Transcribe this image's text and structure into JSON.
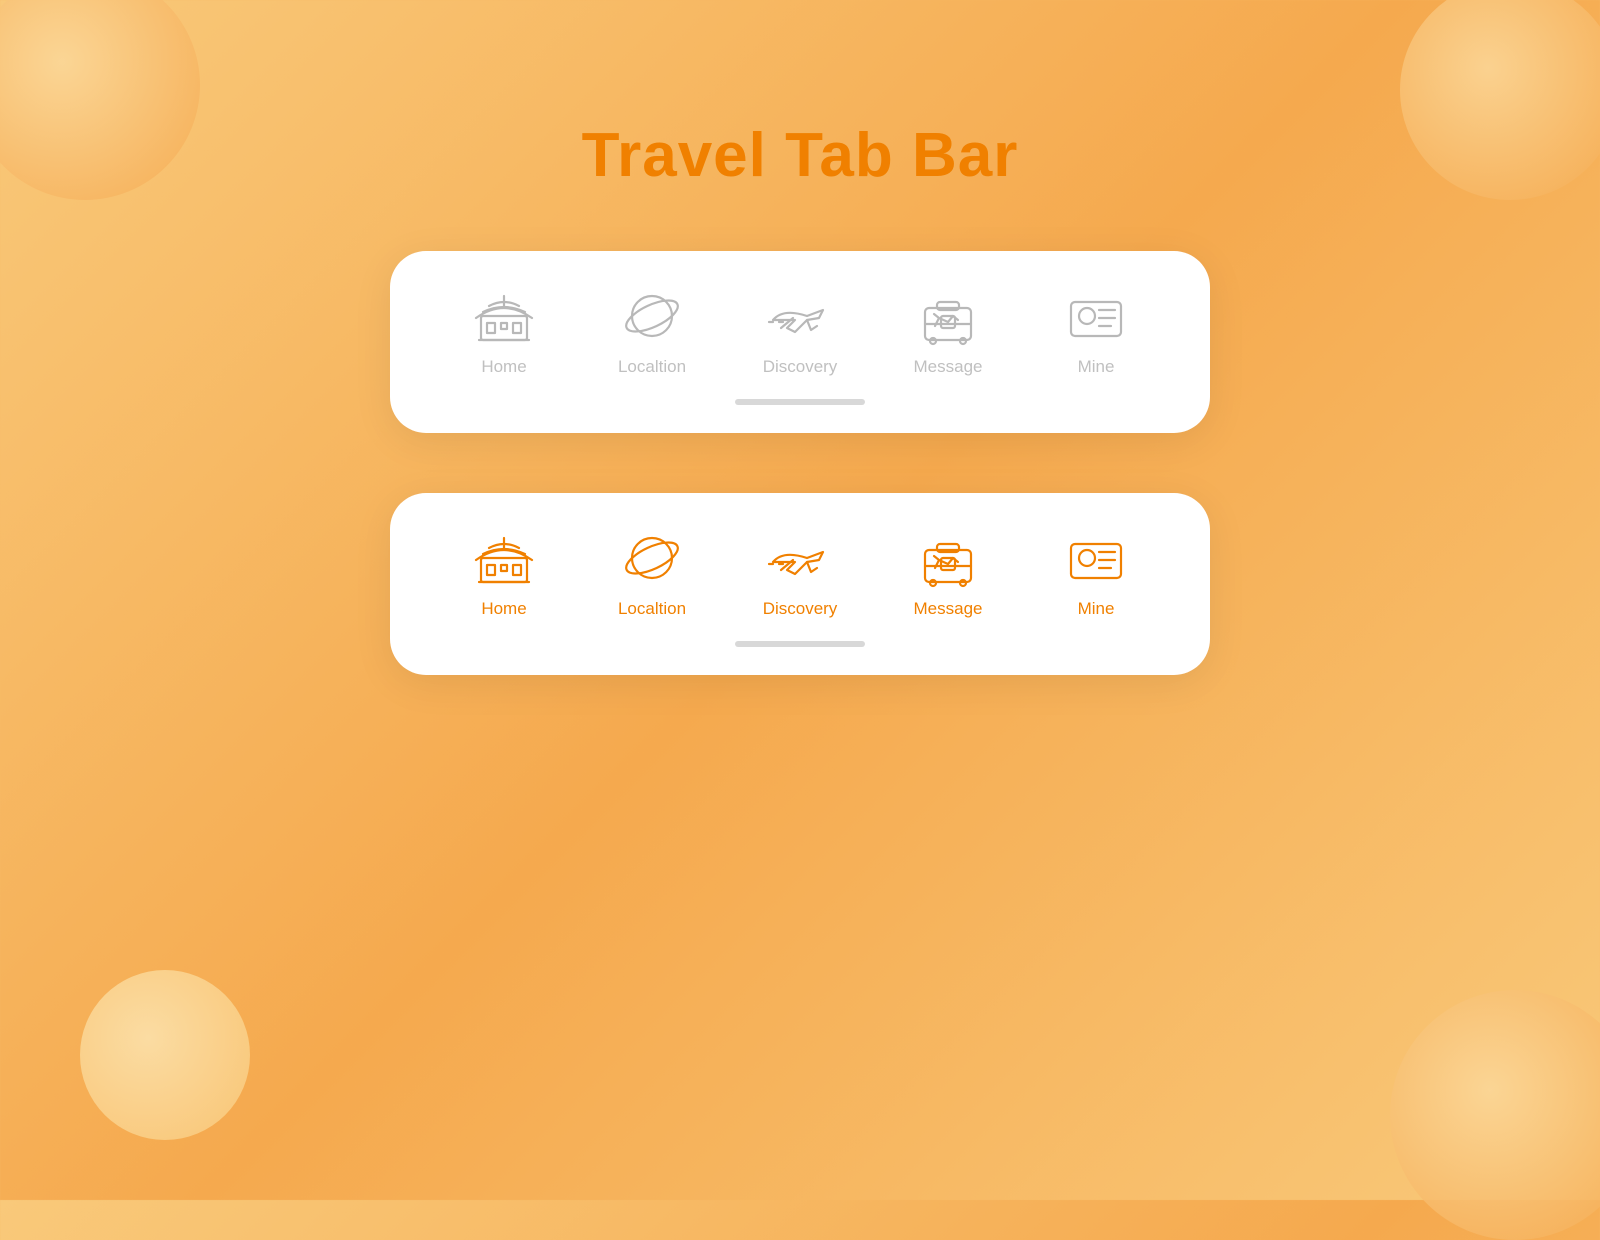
{
  "page": {
    "title": "Travel Tab Bar",
    "background_gradient": "#f9c97a to #f5a94e"
  },
  "accent_color": "#f08000",
  "gray_color": "#b8b8b8",
  "tab_bars": [
    {
      "id": "inactive",
      "active_index": -1,
      "tabs": [
        {
          "label": "Home",
          "icon": "home-icon"
        },
        {
          "label": "Localtion",
          "icon": "location-icon"
        },
        {
          "label": "Discovery",
          "icon": "discovery-icon"
        },
        {
          "label": "Message",
          "icon": "message-icon"
        },
        {
          "label": "Mine",
          "icon": "mine-icon"
        }
      ]
    },
    {
      "id": "active",
      "active_index": -1,
      "tabs": [
        {
          "label": "Home",
          "icon": "home-icon"
        },
        {
          "label": "Localtion",
          "icon": "location-icon"
        },
        {
          "label": "Discovery",
          "icon": "discovery-icon"
        },
        {
          "label": "Message",
          "icon": "message-icon"
        },
        {
          "label": "Mine",
          "icon": "mine-icon"
        }
      ]
    }
  ]
}
